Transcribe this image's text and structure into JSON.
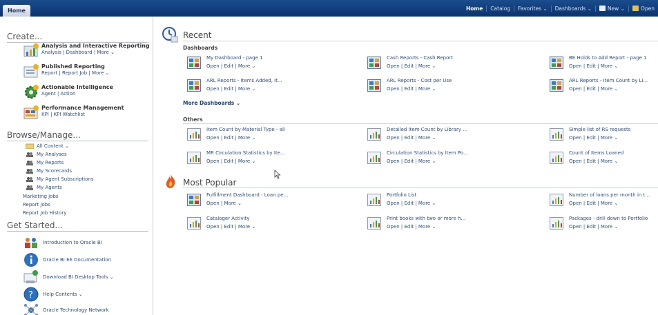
{
  "app": {
    "home_tab": "Home"
  },
  "nav": {
    "items": [
      "Home",
      "Catalog",
      "Favorites ⌄",
      "Dashboards ⌄",
      "New ⌄",
      "Open"
    ]
  },
  "left": {
    "create": {
      "title": "Create...",
      "items": [
        {
          "title": "Analysis and Interactive Reporting",
          "links": "Analysis | Dashboard | More ⌄"
        },
        {
          "title": "Published Reporting",
          "links": "Report | Report Job | More ⌄"
        },
        {
          "title": "Actionable Intelligence",
          "links": "Agent | Action"
        },
        {
          "title": "Performance Management",
          "links": "KPI | KPI Watchlist"
        }
      ]
    },
    "browse": {
      "title": "Browse/Manage...",
      "items": [
        "All Content ⌄",
        "My Analyses",
        "My Reports",
        "My Scorecards",
        "My Agent Subscriptions",
        "My Agents"
      ],
      "plain": [
        "Marketing Jobs",
        "Report Jobs",
        "Report Job History"
      ]
    },
    "started": {
      "title": "Get Started...",
      "items": [
        "Introduction to Oracle BI",
        "Oracle BI EE Documentation",
        "Download BI Desktop Tools ⌄",
        "Help Contents ⌄",
        "Oracle Technology Network"
      ]
    }
  },
  "recent": {
    "title": "Recent",
    "dash_label": "Dashboards",
    "dashboards": [
      {
        "name": "My Dashboard - page 1",
        "actions": "Open | Edit | More ⌄"
      },
      {
        "name": "Cash Reports - Cash Report",
        "actions": "Open | Edit | More ⌄"
      },
      {
        "name": "BE Holds to Add Report - page 1",
        "actions": "Open | Edit | More ⌄"
      },
      {
        "name": "ARL Reports - Items Added, It...",
        "actions": "Open | Edit | More ⌄"
      },
      {
        "name": "ARL Reports - Cost per Use",
        "actions": "Open | Edit | More ⌄"
      },
      {
        "name": "ARL Reports - Item Count by Li...",
        "actions": "Open | Edit | More ⌄"
      }
    ],
    "more_dashboards": "More Dashboards ⌄",
    "others_label": "Others",
    "others": [
      {
        "name": "Item Count by Material Type - all",
        "actions": "Open | Edit | More ⌄"
      },
      {
        "name": "Detailed Item Count by Library ...",
        "actions": "Open | Edit | More ⌄"
      },
      {
        "name": "Simple list of RS requests",
        "actions": "Open | Edit | More ⌄"
      },
      {
        "name": "MR Circulation Statistics by Ite...",
        "actions": "Open | Edit | More ⌄"
      },
      {
        "name": "Circulation Statistics by Item Po...",
        "actions": "Open | Edit | More ⌄"
      },
      {
        "name": "Count of Items Loaned",
        "actions": "Open | Edit | More ⌄"
      }
    ]
  },
  "popular": {
    "title": "Most Popular",
    "items": [
      {
        "name": "Fulfillment Dashboard - Loan pe...",
        "actions": "Open | More ⌄",
        "icon": "dashboard"
      },
      {
        "name": "Portfolio List",
        "actions": "Open | Edit | More ⌄",
        "icon": "report"
      },
      {
        "name": "Number of loans per month in t...",
        "actions": "Open | Edit | More ⌄",
        "icon": "report"
      },
      {
        "name": "Cataloger Activity",
        "actions": "Open | Edit | More ⌄",
        "icon": "report"
      },
      {
        "name": "Print books with two or more h...",
        "actions": "Open | Edit | More ⌄",
        "icon": "report"
      },
      {
        "name": "Packages - drill down to Portfolio",
        "actions": "Open | Edit | More ⌄",
        "icon": "report"
      }
    ]
  }
}
